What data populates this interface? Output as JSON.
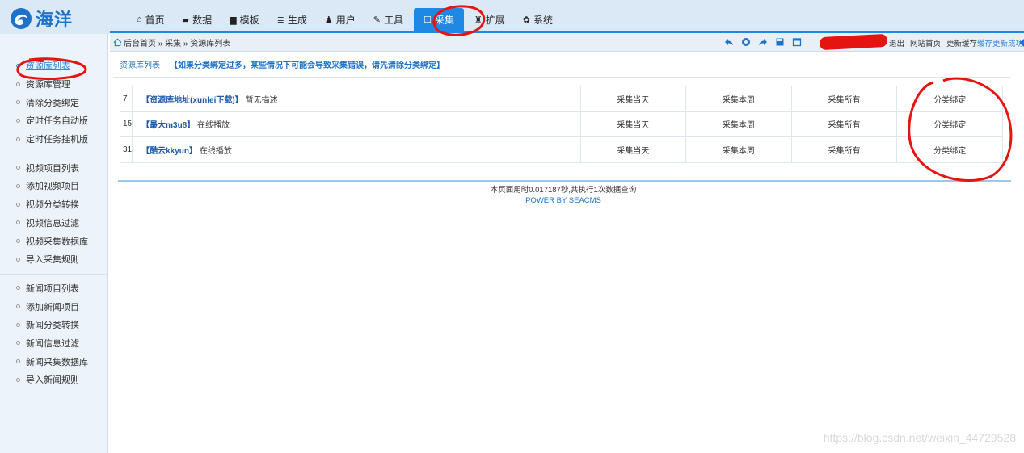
{
  "logo": {
    "text": "海洋",
    "icon": "swirl-logo-icon"
  },
  "nav": [
    {
      "icon": "home-icon",
      "glyph": "⌂",
      "label": "首页"
    },
    {
      "icon": "book-icon",
      "glyph": "▰",
      "label": "数据"
    },
    {
      "icon": "file-icon",
      "glyph": "▆",
      "label": "模板"
    },
    {
      "icon": "list-icon",
      "glyph": "≣",
      "label": "生成"
    },
    {
      "icon": "user-icon",
      "glyph": "♟",
      "label": "用户"
    },
    {
      "icon": "wrench-icon",
      "glyph": "✎",
      "label": "工具"
    },
    {
      "icon": "edit-icon",
      "glyph": "☐",
      "label": "采集",
      "active": true
    },
    {
      "icon": "puzzle-icon",
      "glyph": "♜",
      "label": "扩展"
    },
    {
      "icon": "gear-icon",
      "glyph": "✿",
      "label": "系统"
    }
  ],
  "breadcrumb": "后台首页 » 采集 » 资源库列表",
  "toolbar_icons": [
    "back-icon",
    "refresh-icon",
    "forward-icon",
    "save-icon",
    "calendar-icon"
  ],
  "top_links": {
    "logout": "退出",
    "site_home": "网站首页",
    "update_cache": "更新缓存",
    "cache_ok": "缓存更新成功"
  },
  "sidebar": {
    "groups": [
      [
        "资源库列表",
        "资源库管理",
        "清除分类绑定",
        "定时任务自动版",
        "定时任务挂机版"
      ],
      [
        "视频项目列表",
        "添加视频项目",
        "视频分类转换",
        "视频信息过滤",
        "视频采集数据库",
        "导入采集规则"
      ],
      [
        "新闻项目列表",
        "添加新闻项目",
        "新闻分类转换",
        "新闻信息过滤",
        "新闻采集数据库",
        "导入新闻规则"
      ]
    ]
  },
  "main": {
    "title": "资源库列表",
    "notice": "【如果分类绑定过多，某些情况下可能会导致采集错误，请先清除分类绑定】",
    "rows": [
      {
        "id": "7",
        "name": "【资源库地址(xunlei下载)】",
        "desc": "暂无描述",
        "today": "采集当天",
        "week": "采集本周",
        "all": "采集所有",
        "bind": "分类绑定"
      },
      {
        "id": "15",
        "name": "【最大m3u8】",
        "desc": "在线播放",
        "today": "采集当天",
        "week": "采集本周",
        "all": "采集所有",
        "bind": "分类绑定"
      },
      {
        "id": "31",
        "name": "【酷云kkyun】",
        "desc": "在线播放",
        "today": "采集当天",
        "week": "采集本周",
        "all": "采集所有",
        "bind": "分类绑定"
      }
    ]
  },
  "footer": {
    "line1": "本页面用时0.017187秒,共执行1次数据查询",
    "line2": "POWER BY SEACMS"
  },
  "watermark": "https://blog.csdn.net/weixin_44729528",
  "colors": {
    "accent": "#1e88e5",
    "annotation": "#e61410"
  }
}
